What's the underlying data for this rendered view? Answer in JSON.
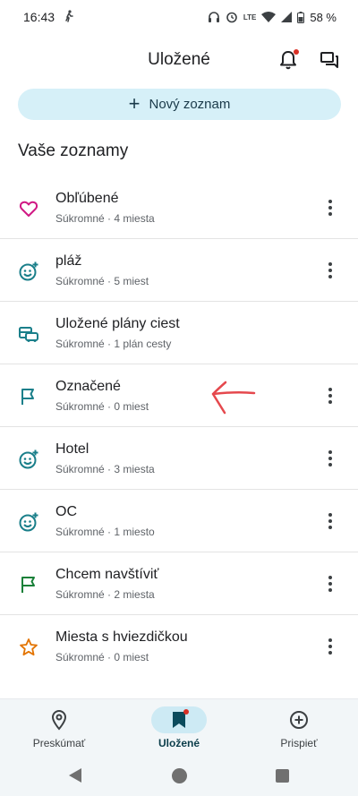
{
  "status_bar": {
    "time": "16:43",
    "network_label": "LTE",
    "battery": "58 %"
  },
  "header": {
    "title": "Uložené",
    "bell_icon": "bell-icon",
    "chat_icon": "chat-icon"
  },
  "new_list_button": {
    "icon": "+",
    "label": "Nový zoznam"
  },
  "section_title": "Vaše zoznamy",
  "lists": [
    {
      "name": "Obľúbené",
      "sub": "Súkromné · 4 miesta",
      "icon": "heart-icon",
      "color": "#d01884",
      "has_menu": true
    },
    {
      "name": "pláž",
      "sub": "Súkromné · 5 miest",
      "icon": "smiley-icon",
      "color": "#1a7f8a",
      "has_menu": true
    },
    {
      "name": "Uložené plány ciest",
      "sub": "Súkromné · 1 plán cesty",
      "icon": "trip-icon",
      "color": "#1a7f8a",
      "has_menu": false
    },
    {
      "name": "Označené",
      "sub": "Súkromné · 0 miest",
      "icon": "flag-outline-icon",
      "color": "#1a7f8a",
      "has_menu": true
    },
    {
      "name": "Hotel",
      "sub": "Súkromné · 3 miesta",
      "icon": "smiley-icon",
      "color": "#1a7f8a",
      "has_menu": true
    },
    {
      "name": "OC",
      "sub": "Súkromné · 1 miesto",
      "icon": "smiley-icon",
      "color": "#1a7f8a",
      "has_menu": true
    },
    {
      "name": "Chcem navštíviť",
      "sub": "Súkromné · 2 miesta",
      "icon": "flag-icon",
      "color": "#188038",
      "has_menu": true
    },
    {
      "name": "Miesta s hviezdičkou",
      "sub": "Súkromné · 0 miest",
      "icon": "star-icon",
      "color": "#e37400",
      "has_menu": true
    }
  ],
  "bottom_nav": [
    {
      "label": "Preskúmať",
      "icon": "location-pin-icon",
      "active": false
    },
    {
      "label": "Uložené",
      "icon": "bookmark-icon",
      "active": true
    },
    {
      "label": "Prispieť",
      "icon": "add-circle-icon",
      "active": false
    }
  ],
  "annotation_color": "#e5484d"
}
